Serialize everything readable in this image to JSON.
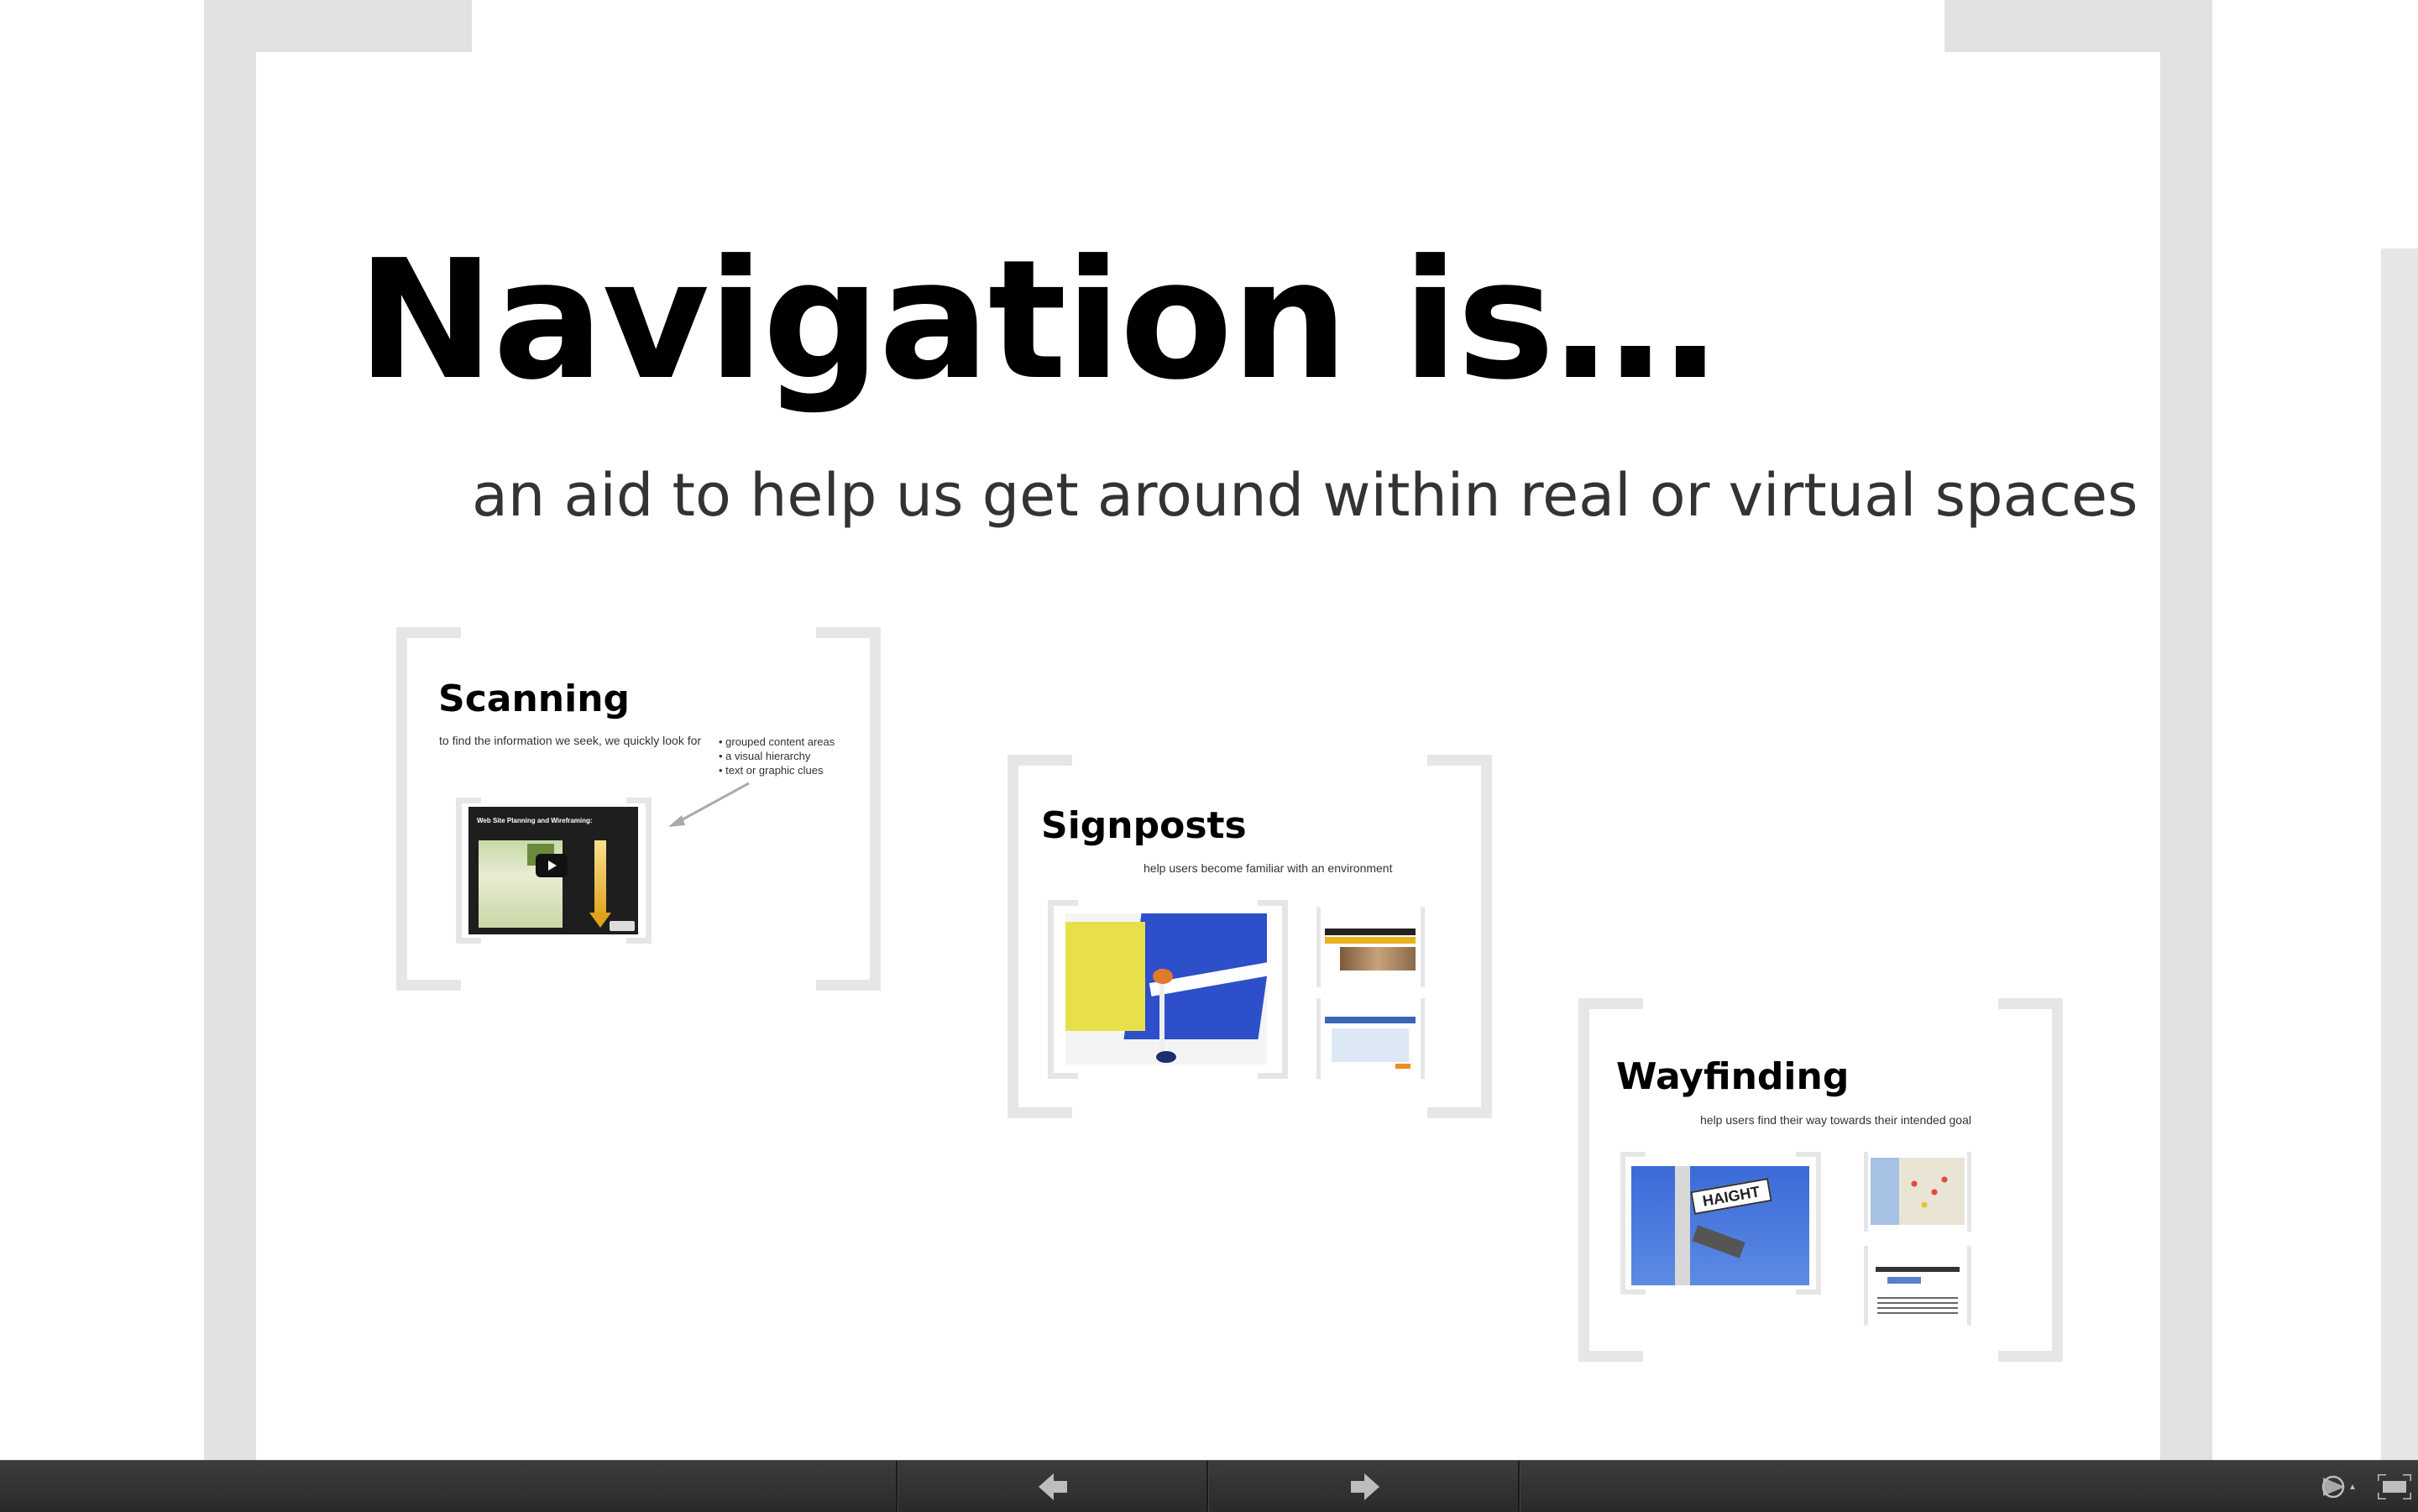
{
  "slide": {
    "title": "Navigation is…",
    "subtitle": "an aid to help us get around within real or virtual spaces"
  },
  "frames": {
    "scanning": {
      "title": "Scanning",
      "lead": "to find the information we seek, we quickly look for",
      "bullets": [
        "• grouped content areas",
        "• a visual hierarchy",
        "• text or graphic clues"
      ],
      "video_title": "Web Site Planning and Wireframing:"
    },
    "signposts": {
      "title": "Signposts",
      "lead": "help users become familiar with an environment"
    },
    "wayfinding": {
      "title": "Wayfinding",
      "lead": "help users find their way towards their intended goal",
      "street_sign": "HAIGHT"
    }
  },
  "toolbar": {
    "prev_icon": "arrow-left-icon",
    "next_icon": "arrow-right-icon",
    "autoplay_icon": "autoplay-icon",
    "fullscreen_icon": "fullscreen-icon"
  }
}
